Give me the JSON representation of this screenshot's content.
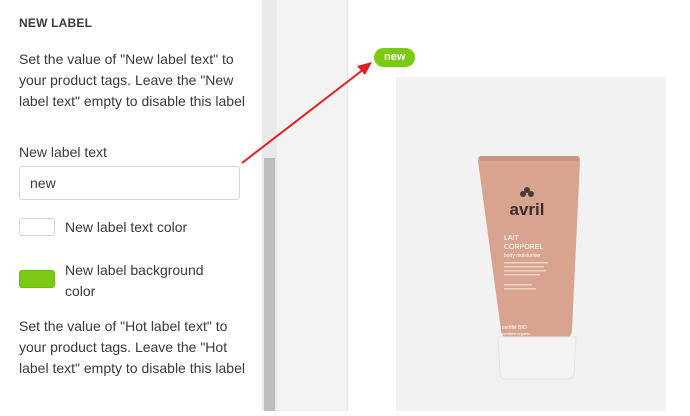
{
  "settings": {
    "section_title": "NEW LABEL",
    "description_new": "Set the value of \"New label text\" to your product tags. Leave the \"New label text\" empty to disable this label",
    "new_label_text_label": "New label text",
    "new_label_text_value": "new",
    "text_color_label": "New label text color",
    "text_color": "#ffffff",
    "bg_color_label": "New label background color",
    "bg_color": "#7cc913",
    "description_hot": "Set the value of \"Hot label text\" to your product tags. Leave the \"Hot label text\" empty to disable this label"
  },
  "preview": {
    "badge_text": "new",
    "product": {
      "brand": "avril",
      "line1": "LAIT",
      "line2": "CORPOREL",
      "subtitle": "body moisturiser",
      "cert": "certifié BIO",
      "cert2": "certified organic"
    },
    "colors": {
      "tube": "#d9a48f",
      "cap": "#f4f4f4",
      "arrow": "#e02020"
    }
  }
}
